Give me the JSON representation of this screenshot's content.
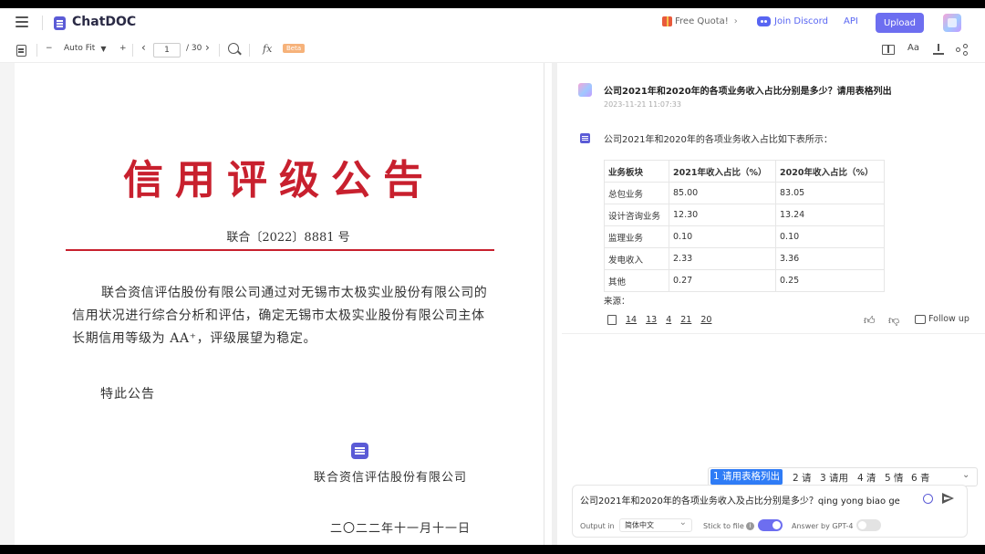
{
  "app": {
    "name": "ChatDOC"
  },
  "header": {
    "quota_label": "Free Quota!",
    "discord_label": "Join Discord",
    "api_label": "API",
    "upload_label": "Upload"
  },
  "toolbar": {
    "zoom_minus": "−",
    "zoom_value": "Auto Fit",
    "zoom_plus": "+",
    "prev_page": "‹",
    "current_page": "1",
    "total_pages": "/ 30",
    "next_page": "›",
    "formula_label": "fx",
    "beta_badge": "Beta",
    "font_button": "Aa"
  },
  "document": {
    "title": "信用评级公告",
    "number": "联合〔2022〕8881 号",
    "body": "联合资信评估股份有限公司通过对无锡市太极实业股份有限公司的信用状况进行综合分析和评估，确定无锡市太极实业股份有限公司主体长期信用等级为 AA⁺，评级展望为稳定。",
    "notice": "特此公告",
    "company": "联合资信评估股份有限公司",
    "date": "二〇二二年十一月十一日"
  },
  "chat": {
    "question": "公司2021年和2020年的各项业务收入占比分别是多少？请用表格列出",
    "question_time": "2023-11-21 11:07:33",
    "answer_intro": "公司2021年和2020年的各项业务收入占比如下表所示：",
    "table": {
      "headers": [
        "业务板块",
        "2021年收入占比（%）",
        "2020年收入占比（%）"
      ],
      "rows": [
        [
          "总包业务",
          "85.00",
          "83.05"
        ],
        [
          "设计咨询业务",
          "12.30",
          "13.24"
        ],
        [
          "监理业务",
          "0.10",
          "0.10"
        ],
        [
          "发电收入",
          "2.33",
          "3.36"
        ],
        [
          "其他",
          "0.27",
          "0.25"
        ]
      ]
    },
    "source_label": "来源：",
    "source_pages": [
      "14",
      "13",
      "4",
      "21",
      "20"
    ],
    "follow_up_label": "Follow up"
  },
  "ime": {
    "candidates": [
      "1 请用表格列出",
      "2 请",
      "3 请用",
      "4 清",
      "5 情",
      "6 青"
    ]
  },
  "input": {
    "value": "公司2021年和2020年的各项业务收入及占比分别是多少？qing yong biao ge lie",
    "output_label": "Output in",
    "language": "简体中文",
    "stick_label": "Stick to file",
    "gpt4_label": "Answer by GPT-4"
  },
  "colors": {
    "accent": "#6d6ef0",
    "title_red": "#c8202e",
    "discord": "#5865f2",
    "ime_selected": "#2f7cf6"
  }
}
